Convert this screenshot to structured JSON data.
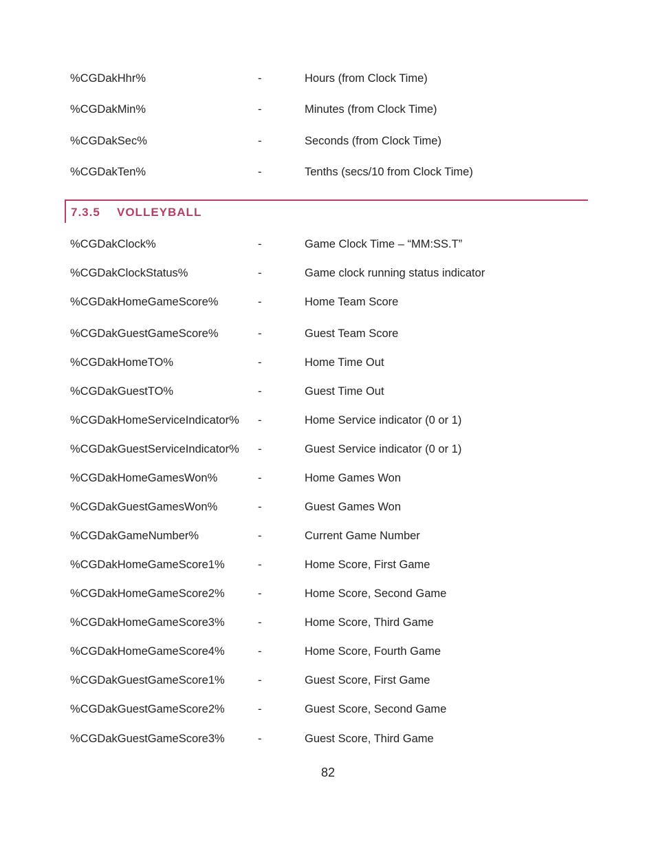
{
  "top_rows": [
    {
      "var": "%CGDakHhr%",
      "dash": "-",
      "desc": "Hours (from Clock Time)"
    },
    {
      "var": "%CGDakMin%",
      "dash": "-",
      "desc": "Minutes (from Clock Time)"
    },
    {
      "var": "%CGDakSec%",
      "dash": "-",
      "desc": "Seconds (from Clock Time)"
    },
    {
      "var": "%CGDakTen%",
      "dash": "-",
      "desc": "Tenths (secs/10 from Clock Time)"
    }
  ],
  "section": {
    "number": "7.3.5",
    "title": "VOLLEYBALL",
    "accent_color": "#b83d66"
  },
  "volleyball_rows": [
    {
      "var": "%CGDakClock%",
      "dash": "-",
      "desc": "Game Clock Time – “MM:SS.T”"
    },
    {
      "var": "%CGDakClockStatus%",
      "dash": "-",
      "desc": "Game clock running status indicator"
    },
    {
      "var": "%CGDakHomeGameScore%",
      "dash": "-",
      "desc": "Home Team Score"
    },
    {
      "var": "%CGDakGuestGameScore%",
      "dash": "-",
      "desc": "Guest Team Score"
    },
    {
      "var": "%CGDakHomeTO%",
      "dash": "-",
      "desc": "Home Time Out"
    },
    {
      "var": "%CGDakGuestTO%",
      "dash": "-",
      "desc": "Guest Time Out"
    },
    {
      "var": "%CGDakHomeServiceIndicator%",
      "dash": "-",
      "desc": "Home Service indicator (0 or 1)"
    },
    {
      "var": "%CGDakGuestServiceIndicator%",
      "dash": "-",
      "desc": "Guest Service indicator (0 or 1)"
    },
    {
      "var": "%CGDakHomeGamesWon%",
      "dash": "-",
      "desc": "Home Games Won"
    },
    {
      "var": "%CGDakGuestGamesWon%",
      "dash": "-",
      "desc": "Guest Games Won"
    },
    {
      "var": "%CGDakGameNumber%",
      "dash": "-",
      "desc": "Current Game Number"
    },
    {
      "var": "%CGDakHomeGameScore1%",
      "dash": "-",
      "desc": "Home Score, First Game"
    },
    {
      "var": "%CGDakHomeGameScore2%",
      "dash": "-",
      "desc": "Home Score, Second Game"
    },
    {
      "var": "%CGDakHomeGameScore3%",
      "dash": "-",
      "desc": "Home Score, Third Game"
    },
    {
      "var": "%CGDakHomeGameScore4%",
      "dash": "-",
      "desc": "Home Score, Fourth Game"
    },
    {
      "var": "%CGDakGuestGameScore1%",
      "dash": "-",
      "desc": "Guest Score, First Game"
    },
    {
      "var": "%CGDakGuestGameScore2%",
      "dash": "-",
      "desc": "Guest Score, Second Game"
    },
    {
      "var": "%CGDakGuestGameScore3%",
      "dash": "-",
      "desc": "Guest Score, Third Game"
    }
  ],
  "page_number": "82"
}
